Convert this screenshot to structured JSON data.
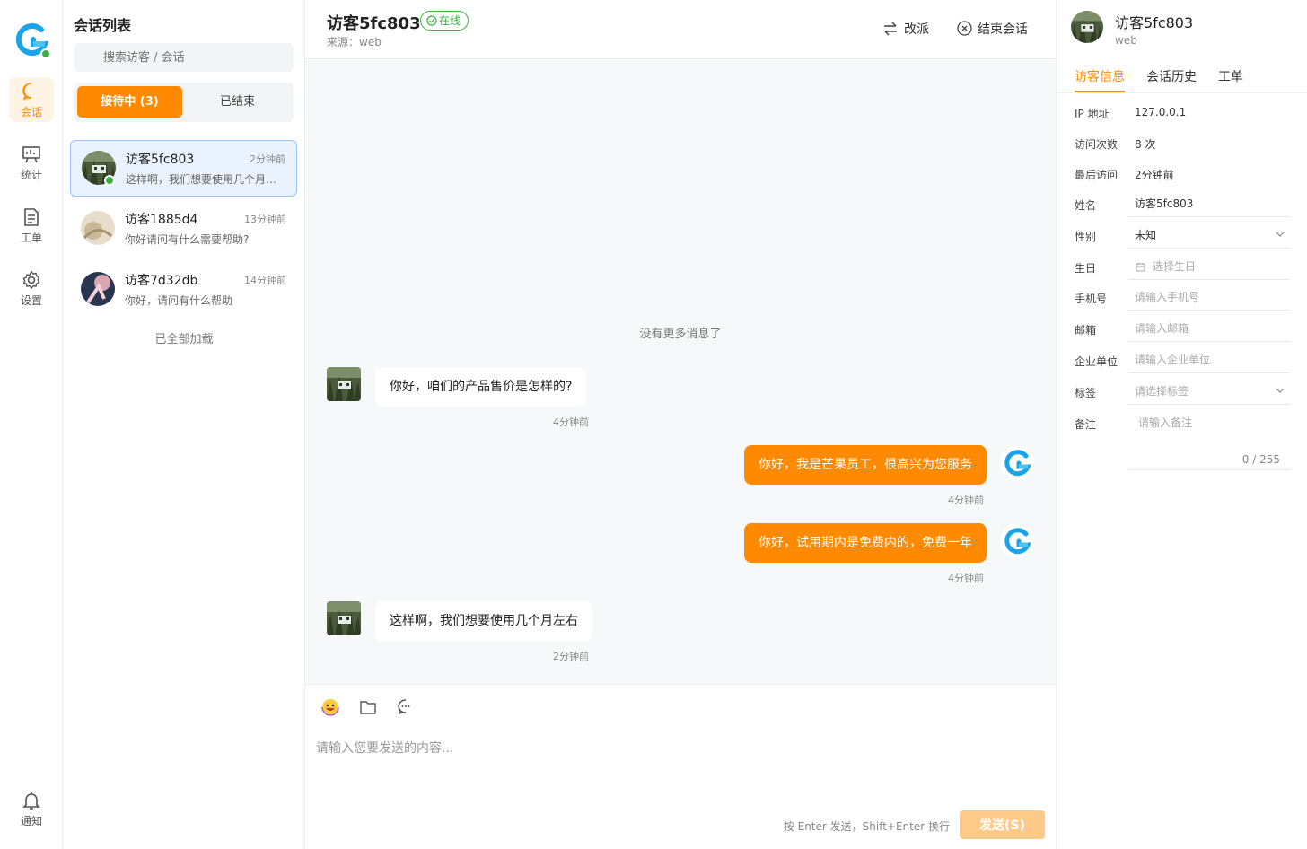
{
  "nav": {
    "items": [
      {
        "label": "会话",
        "icon": "chat-bubble-icon",
        "active": true
      },
      {
        "label": "统计",
        "icon": "chart-board-icon"
      },
      {
        "label": "工单",
        "icon": "document-icon"
      },
      {
        "label": "设置",
        "icon": "gear-icon"
      }
    ],
    "notify_label": "通知"
  },
  "list": {
    "title": "会话列表",
    "search_placeholder": "搜索访客 / 会话",
    "tab_active": "接待中 (3)",
    "tab_ended": "已结束",
    "conversations": [
      {
        "name": "访客5fc803",
        "time": "2分钟前",
        "preview": "这样啊，我们想要使用几个月左右"
      },
      {
        "name": "访客1885d4",
        "time": "13分钟前",
        "preview": "你好请问有什么需要帮助?"
      },
      {
        "name": "访客7d32db",
        "time": "14分钟前",
        "preview": "你好，请问有什么帮助"
      }
    ],
    "all_loaded": "已全部加载"
  },
  "chat": {
    "name": "访客5fc803",
    "status": "在线",
    "source": "来源：web",
    "reassign": "改派",
    "end": "结束会话",
    "no_more": "没有更多消息了",
    "messages": [
      {
        "dir": "in",
        "text": "你好，咱们的产品售价是怎样的?",
        "time": "4分钟前"
      },
      {
        "dir": "out",
        "text": "你好，我是芒果员工，很高兴为您服务",
        "time": "4分钟前"
      },
      {
        "dir": "out",
        "text": "你好，试用期内是免费内的，免费一年",
        "time": "4分钟前"
      },
      {
        "dir": "in",
        "text": "这样啊，我们想要使用几个月左右",
        "time": "2分钟前"
      }
    ],
    "input_placeholder": "请输入您要发送的内容...",
    "hint": "按 Enter 发送，Shift+Enter 换行",
    "send": "发送(S)"
  },
  "profile": {
    "name": "访客5fc803",
    "source": "web",
    "tabs": [
      "访客信息",
      "会话历史",
      "工单"
    ],
    "fields": {
      "ip_label": "IP 地址",
      "ip": "127.0.0.1",
      "visits_label": "访问次数",
      "visits": "8 次",
      "last_label": "最后访问",
      "last": "2分钟前",
      "name_label": "姓名",
      "name_value": "访客5fc803",
      "gender_label": "性别",
      "gender_value": "未知",
      "birthday_label": "生日",
      "birthday_placeholder": "选择生日",
      "phone_label": "手机号",
      "phone_placeholder": "请输入手机号",
      "email_label": "邮箱",
      "email_placeholder": "请输入邮箱",
      "company_label": "企业单位",
      "company_placeholder": "请输入企业单位",
      "tags_label": "标签",
      "tags_placeholder": "请选择标签",
      "remark_label": "备注",
      "remark_placeholder": "请输入备注",
      "remark_count": "0 / 255"
    }
  },
  "colors": {
    "accent": "#ff8a00",
    "online": "#3cb043",
    "selected_bg": "#eaf2fe"
  }
}
